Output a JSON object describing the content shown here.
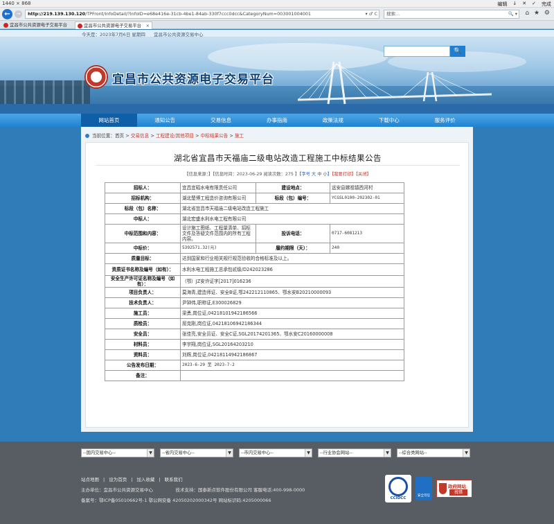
{
  "system": {
    "resolution": "1440 × 868",
    "controls": [
      "编辑",
      "↓",
      "✕",
      "✓",
      "完成"
    ]
  },
  "browser": {
    "url_host": "http://219.139.130.120",
    "url_path": "/TPFront/InfoDetail/?InfoID=e68e416e-31cb-4be1-84ab-330f7ccc0dcc&CategoryNum=003001004001",
    "url_tools": "▾ ♂ C",
    "search_placeholder": "搜索...",
    "search_tools": "🔍 ▾",
    "toolbar_icons": "⌂ ★ ⚙",
    "tabs": [
      {
        "label": "宜昌市公共资源电子交易平台"
      },
      {
        "label": "宜昌市公共资源电子交易平台"
      }
    ]
  },
  "site": {
    "today": "今天是：2023年7月6日 星期四",
    "center": "宜昌市公共资源交易中心",
    "logo_text": "宜昌市公共资源电子交易平台",
    "search_button": "🔍",
    "nav": [
      "网站首页",
      "通知公告",
      "交易信息",
      "办事指南",
      "政策法规",
      "下载中心",
      "服务评价"
    ]
  },
  "breadcrumb": {
    "prefix": "当前位置：",
    "home": "首页",
    "sep": " > ",
    "items": [
      "交易信息",
      "工程建设/其他项目",
      "中标结果公告",
      "施工"
    ]
  },
  "article": {
    "title": "湖北省宜昌市天福庙二级电站改造工程施工中标结果公告",
    "meta_source": "【信息来源：】",
    "meta_time": "【信息时间：2023-06-29 阅读次数：275 】",
    "meta_font": "【字号 大 中 小】",
    "meta_print": "【我要打印】",
    "meta_close": "【关闭】"
  },
  "table": {
    "r1": {
      "l1": "招标人：",
      "v1": "宜昌宜昭水电有限责任公司",
      "l2": "建设地点：",
      "v2": "远安县嫘祖镇西河村"
    },
    "r2": {
      "l1": "招标机构：",
      "v1": "湖北楚博工程造价咨询有限公司",
      "l2": "标段（包）编号：",
      "v2": "YCGSL0100-202302-01"
    },
    "r3": {
      "l": "标段（包）名称：",
      "v": "湖北省宜昌市天福庙二级电站改造工程施工"
    },
    "r4": {
      "l": "中标人：",
      "v": "湖北宏盛水利水电工程有限公司"
    },
    "r5": {
      "l1": "中标范围和内容：",
      "v1": "设计施工图纸、工程量清单、招标文件及答疑文件范围内的所有工程内容。",
      "l2": "投诉电话：",
      "v2": "0717-6081213"
    },
    "r6": {
      "l1": "中标价：",
      "v1": "5392571.32(元)",
      "l2": "履约期限（天）：",
      "v2": "240"
    },
    "r7": {
      "l": "质量目标：",
      "v": "达到国家和行业相关规行规范验收的合格标准及以上。"
    },
    "r8": {
      "l": "资质证书名称及编号（如有）：",
      "v": "水利水电工程施工总承包贰级/D242023286"
    },
    "r9": {
      "l": "安全生产许可证名称及编号（如有）：",
      "v": "（鄂）JZ安许证字[2017]016236"
    },
    "r10": {
      "l": "项目负责人：",
      "v": "莫海青,建造师证、安全B证,鄂242212110865、鄂水安B20210000093"
    },
    "r11": {
      "l": "技术负责人：",
      "v": "尹钟伟,职称证,E300026829"
    },
    "r12": {
      "l": "施工员：",
      "v": "梁勇,岗位证,04218101942186566"
    },
    "r13": {
      "l": "质检员：",
      "v": "屈克刚,岗位证,04218106942186344"
    },
    "r14": {
      "l": "安全员：",
      "v": "张佳亮,安全员证、安全C证,SGL20174201365、鄂水安C20160000008"
    },
    "r15": {
      "l": "材料员：",
      "v": "李宇翔,岗位证,SGL20164203210"
    },
    "r16": {
      "l": "资料员：",
      "v": "刘辉,岗位证,04218114942186867"
    },
    "r17": {
      "l": "公告发布日期：",
      "v": "2023-6-29 至 2023-7-2"
    },
    "r18": {
      "l": "备注：",
      "v": ""
    }
  },
  "footer": {
    "selects": [
      "--国内交易中心--",
      "--省内交易中心--",
      "--市内交易中心--",
      "--行业协会网站--",
      "--综合类网站--"
    ],
    "links": [
      "站点地图",
      "|",
      "设为首页",
      "|",
      "加入收藏",
      "|",
      "联系我们"
    ],
    "host_line": "主办单位：宜昌市公共资源交易中心　　　　　技术支持：国泰新点软件股份有限公司 客服电话:400-998-0000",
    "icp_line": "备案号：鄂ICP备05010662号-1  鄂公网安备 42050202000342号  网站标识码:4205000066",
    "badge1": "CCIDCC",
    "badge2": "安全可信",
    "badge3_top": "政府网站",
    "badge3_bottom": "找错"
  }
}
